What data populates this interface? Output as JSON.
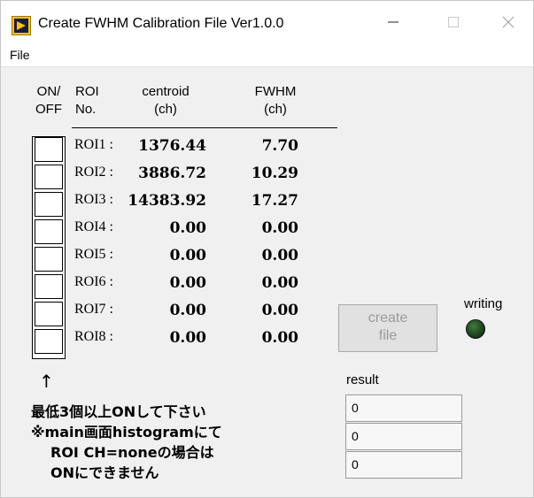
{
  "window": {
    "title": "Create FWHM Calibration File  Ver1.0.0",
    "minimize_icon": "minimize-icon",
    "maximize_icon": "maximize-icon",
    "close_icon": "close-icon"
  },
  "menu": {
    "file_label": "File"
  },
  "table": {
    "headers": {
      "on_off": [
        "ON/",
        "OFF"
      ],
      "roi_no": [
        "ROI",
        "No."
      ],
      "centroid": [
        "centroid",
        "(ch)"
      ],
      "fwhm": [
        "FWHM",
        "(ch)"
      ]
    },
    "rows": [
      {
        "label": "ROI1 :",
        "centroid": "1376.44",
        "fwhm": "7.70",
        "checked": false
      },
      {
        "label": "ROI2 :",
        "centroid": "3886.72",
        "fwhm": "10.29",
        "checked": false
      },
      {
        "label": "ROI3 :",
        "centroid": "14383.92",
        "fwhm": "17.27",
        "checked": false
      },
      {
        "label": "ROI4 :",
        "centroid": "0.00",
        "fwhm": "0.00",
        "checked": false
      },
      {
        "label": "ROI5 :",
        "centroid": "0.00",
        "fwhm": "0.00",
        "checked": false
      },
      {
        "label": "ROI6 :",
        "centroid": "0.00",
        "fwhm": "0.00",
        "checked": false
      },
      {
        "label": "ROI7 :",
        "centroid": "0.00",
        "fwhm": "0.00",
        "checked": false
      },
      {
        "label": "ROI8 :",
        "centroid": "0.00",
        "fwhm": "0.00",
        "checked": false
      }
    ]
  },
  "create_button": {
    "label": "create\nfile"
  },
  "writing": {
    "label": "writing",
    "led_color": "#1f4a1f"
  },
  "result": {
    "label": "result",
    "values": [
      "0",
      "0",
      "0"
    ]
  },
  "notes": {
    "arrow": "↑",
    "line1": "最低3個以上ONして下さい",
    "line2": "※main画面histogramにて",
    "line3": "ROI CH=noneの場合は",
    "line4": "ONにできません"
  }
}
